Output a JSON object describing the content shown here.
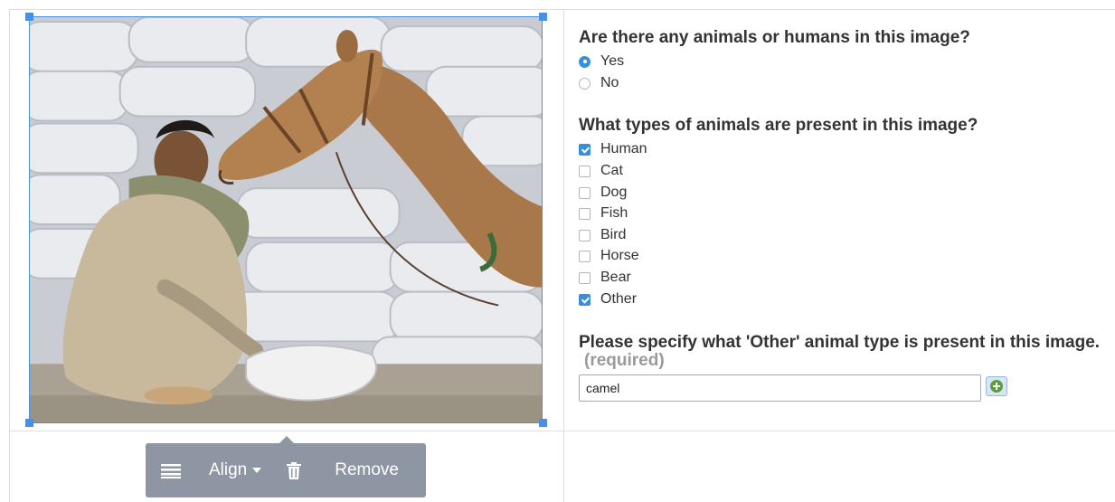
{
  "image": {
    "alt": ""
  },
  "toolbar": {
    "align_label": "Align",
    "remove_label": "Remove"
  },
  "question1": {
    "title": "Are there any animals or humans in this image?",
    "options": [
      {
        "label": "Yes",
        "selected": true
      },
      {
        "label": "No",
        "selected": false
      }
    ]
  },
  "question2": {
    "title": "What types of animals are present in this image?",
    "options": [
      {
        "label": "Human",
        "checked": true
      },
      {
        "label": "Cat",
        "checked": false
      },
      {
        "label": "Dog",
        "checked": false
      },
      {
        "label": "Fish",
        "checked": false
      },
      {
        "label": "Bird",
        "checked": false
      },
      {
        "label": "Horse",
        "checked": false
      },
      {
        "label": "Bear",
        "checked": false
      },
      {
        "label": "Other",
        "checked": true
      }
    ]
  },
  "question3": {
    "title": "Please specify what 'Other' animal type is present in this image.",
    "required_label": "(required)",
    "value": "camel"
  },
  "colors": {
    "accent": "#3b8fd9",
    "selection": "#4a90e2",
    "toolbar_bg": "#8e95a3",
    "add_button_icon": "#5aa03a"
  }
}
